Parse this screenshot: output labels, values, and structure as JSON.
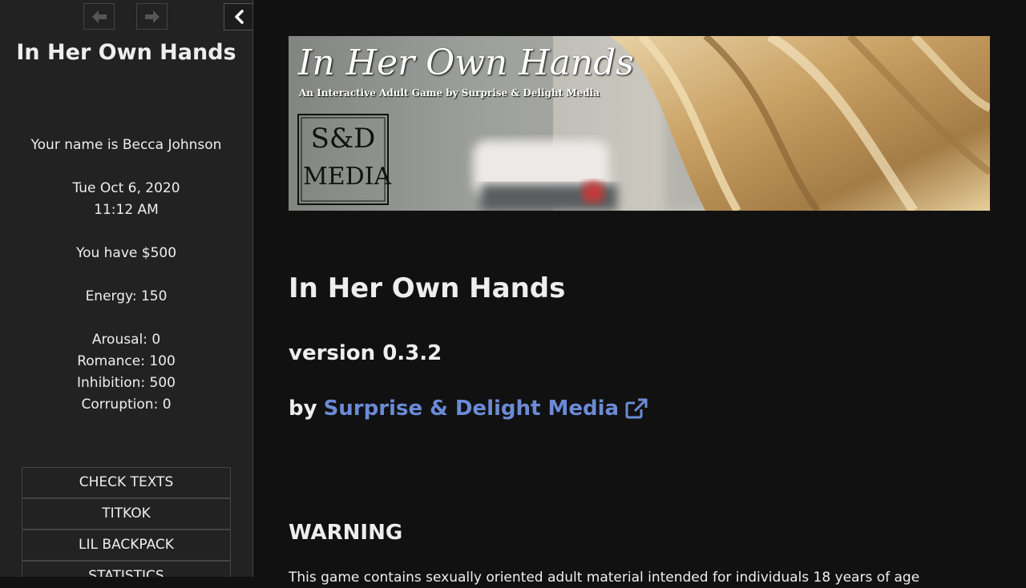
{
  "sidebar": {
    "story_title": "In Her Own Hands",
    "caption": {
      "name_line": "Your name is Becca Johnson",
      "date": "Tue Oct 6, 2020",
      "time": "11:12 AM",
      "money": "You have $500",
      "energy": "Energy: 150",
      "arousal": "Arousal: 0",
      "romance": "Romance: 100",
      "inhibition": "Inhibition: 500",
      "corruption": "Corruption: 0"
    },
    "menu": [
      {
        "label": "CHECK TEXTS"
      },
      {
        "label": "TITKOK"
      },
      {
        "label": "LIL BACKPACK"
      },
      {
        "label": "STATISTICS"
      }
    ]
  },
  "banner": {
    "logo_title": "In Her Own Hands",
    "logo_subtitle": "An Interactive Adult Game by Surprise & Delight Media",
    "seal_top": "S&D",
    "seal_bottom": "MEDIA"
  },
  "main": {
    "title": "In Her Own Hands",
    "version": "version 0.3.2",
    "by": "by",
    "author": "Surprise & Delight Media",
    "warning_heading": "WARNING",
    "warning_text": "This game contains sexually oriented adult material intended for individuals 18 years of age"
  },
  "colors": {
    "sidebar_bg": "#222222",
    "main_bg": "#111111",
    "link": "#6b8bd6"
  }
}
